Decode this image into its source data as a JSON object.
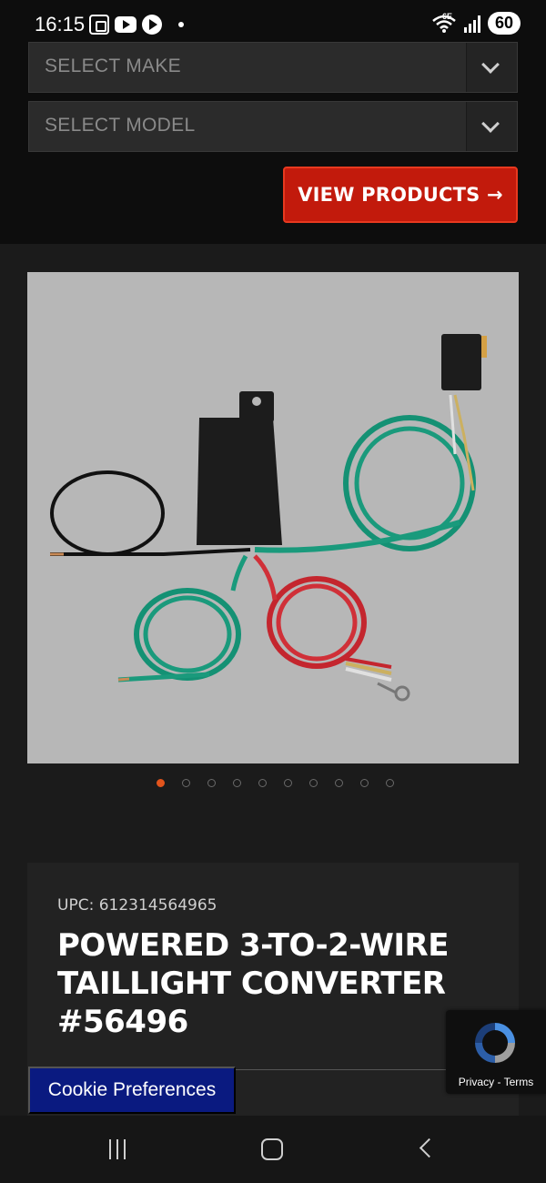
{
  "status_bar": {
    "time": "16:15",
    "network_label": "6E",
    "battery": "60"
  },
  "selector": {
    "make_placeholder": "SELECT MAKE",
    "model_placeholder": "SELECT MODEL",
    "view_products_label": "VIEW PRODUCTS →",
    "button_color": "#c21a0c"
  },
  "carousel": {
    "image_icon": "product-photo",
    "total_slides": 10,
    "active_index": 0,
    "accent_color": "#e2541c"
  },
  "product": {
    "upc": "UPC: 612314564965",
    "title_line1": "POWERED 3-TO-2-WIRE",
    "title_line2": "TAILLIGHT CONVERTER",
    "title_line3": "#56496"
  },
  "cookie": {
    "label": "Cookie Preferences",
    "color": "#0a1a80"
  },
  "recaptcha": {
    "privacy": "Privacy",
    "separator": " - ",
    "terms": "Terms"
  },
  "nav": {
    "icons": [
      "recents-icon",
      "home-icon",
      "back-icon"
    ]
  }
}
